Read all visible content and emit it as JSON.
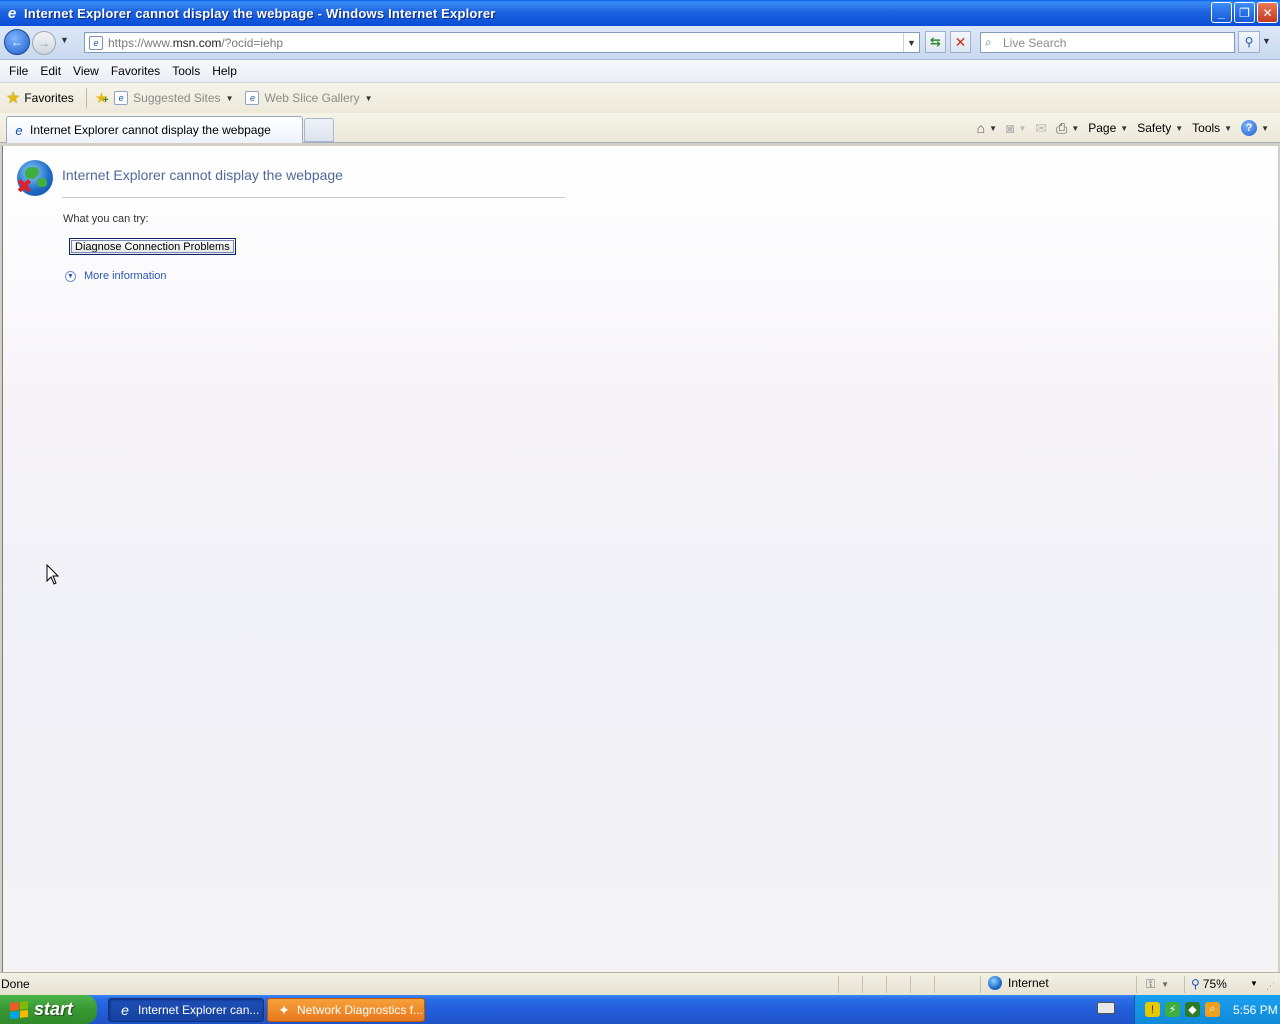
{
  "window": {
    "title": "Internet Explorer cannot display the webpage - Windows Internet Explorer",
    "minimize_glyph": "_",
    "restore_glyph": "❐",
    "close_glyph": "✕"
  },
  "navbar": {
    "back_glyph": "←",
    "forward_glyph": "→",
    "address_prefix": "https://www.",
    "address_host": "msn.com",
    "address_suffix": "/?ocid=iehp",
    "search_placeholder": "Live Search"
  },
  "menu": {
    "items": [
      "File",
      "Edit",
      "View",
      "Favorites",
      "Tools",
      "Help"
    ]
  },
  "favorites_bar": {
    "favorites_label": "Favorites",
    "items": [
      "Suggested Sites",
      "Web Slice Gallery"
    ]
  },
  "tabs": {
    "active_tab_title": "Internet Explorer cannot display the webpage"
  },
  "command_bar": {
    "page_label": "Page",
    "safety_label": "Safety",
    "tools_label": "Tools"
  },
  "content": {
    "error_title": "Internet Explorer cannot display the webpage",
    "try_label": "What you can try:",
    "diagnose_button": "Diagnose Connection Problems",
    "more_info_link": "More information"
  },
  "status_bar": {
    "status_text": "Done",
    "zone": "Internet",
    "zoom": "75%"
  },
  "taskbar": {
    "start_label": "start",
    "tasks": [
      "Internet Explorer can...",
      "Network Diagnostics f..."
    ],
    "clock": "5:56 PM"
  },
  "colors": {
    "title_bar": "#1e64e0",
    "link": "#2a57b0",
    "error_title": "#4f6a9a",
    "start_button": "#3a9a35",
    "active_task": "#16429f",
    "flashing_task": "#e8781c"
  },
  "icons": [
    "ie-icon",
    "back-icon",
    "forward-icon",
    "refresh-icon",
    "stop-icon",
    "search-icon",
    "star-icon",
    "add-favorite-icon",
    "home-icon",
    "feeds-icon",
    "mail-icon",
    "print-icon",
    "help-icon",
    "globe-error-icon",
    "expand-icon",
    "internet-zone-icon",
    "zoom-icon",
    "windows-flag-icon"
  ]
}
